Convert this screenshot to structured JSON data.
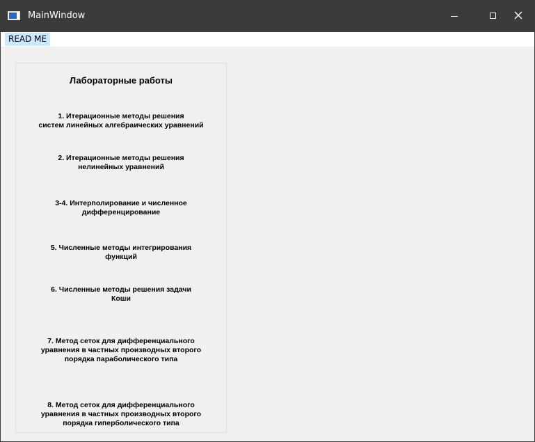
{
  "window": {
    "title": "MainWindow",
    "buttons": {
      "minimize_icon": "minimize-icon",
      "maximize_icon": "maximize-icon",
      "close_icon": "close-icon"
    }
  },
  "menu": {
    "items": [
      {
        "label": "READ ME"
      }
    ]
  },
  "panel": {
    "title": "Лабораторные работы",
    "items": [
      {
        "lines": [
          "1. Итерационные методы решения",
          "систем линейных алгебраических уравнений"
        ]
      },
      {
        "lines": [
          "2. Итерационные методы решения",
          "нелинейных уравнений"
        ]
      },
      {
        "lines": [
          "3-4. Интерполирование  и численное",
          "дифференцирование"
        ]
      },
      {
        "lines": [
          "5. Численные методы интегрирования",
          "функций"
        ]
      },
      {
        "lines": [
          "6. Численные методы решения задачи",
          "Коши"
        ]
      },
      {
        "lines": [
          "7. Метод сеток для дифференциального",
          "уравнения в частных  производных второго",
          "порядка параболического типа"
        ]
      },
      {
        "lines": [
          "8. Метод сеток для дифференциального",
          "уравнения в частных  производных второго",
          "порядка гиперболического типа"
        ]
      }
    ]
  }
}
